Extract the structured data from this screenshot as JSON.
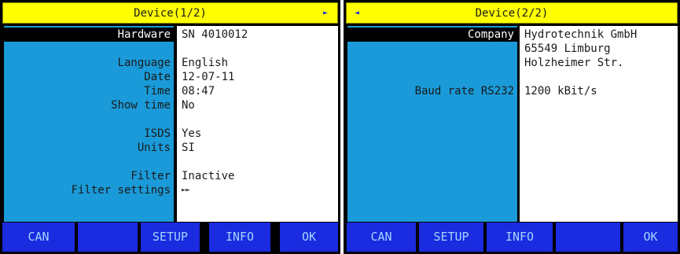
{
  "colors": {
    "title_bar": "#ffff00",
    "label_column": "#1a9ad8",
    "value_column": "#ffffff",
    "highlight": "#000000",
    "footer_button": "#1a2be0",
    "footer_text": "#9fd7ff",
    "arrow": "#1a2fd6"
  },
  "panel1": {
    "title": "Device(1/2)",
    "nav_arrow": "►",
    "rows": [
      {
        "label": "Hardware",
        "value": "SN 4010012"
      },
      {
        "label": "Language",
        "value": "English"
      },
      {
        "label": "Date",
        "value": "12-07-11"
      },
      {
        "label": "Time",
        "value": "08:47"
      },
      {
        "label": "Show time",
        "value": "No"
      },
      {
        "label": "ISDS",
        "value": "Yes"
      },
      {
        "label": "Units",
        "value": "SI"
      },
      {
        "label": "Filter",
        "value": "Inactive"
      },
      {
        "label": "Filter settings",
        "value": "►►"
      }
    ],
    "footer": [
      "CAN",
      "",
      "SETUP",
      "INFO",
      "OK"
    ]
  },
  "panel2": {
    "title": "Device(2/2)",
    "nav_arrow": "◄",
    "rows": [
      {
        "label": "Company",
        "value": "Hydrotechnik GmbH"
      },
      {
        "label": "",
        "value": "65549 Limburg"
      },
      {
        "label": "",
        "value": "Holzheimer Str."
      },
      {
        "label": "Baud rate RS232",
        "value": "1200 kBit/s"
      }
    ],
    "footer": [
      "CAN",
      "SETUP",
      "INFO",
      "",
      "OK"
    ]
  }
}
